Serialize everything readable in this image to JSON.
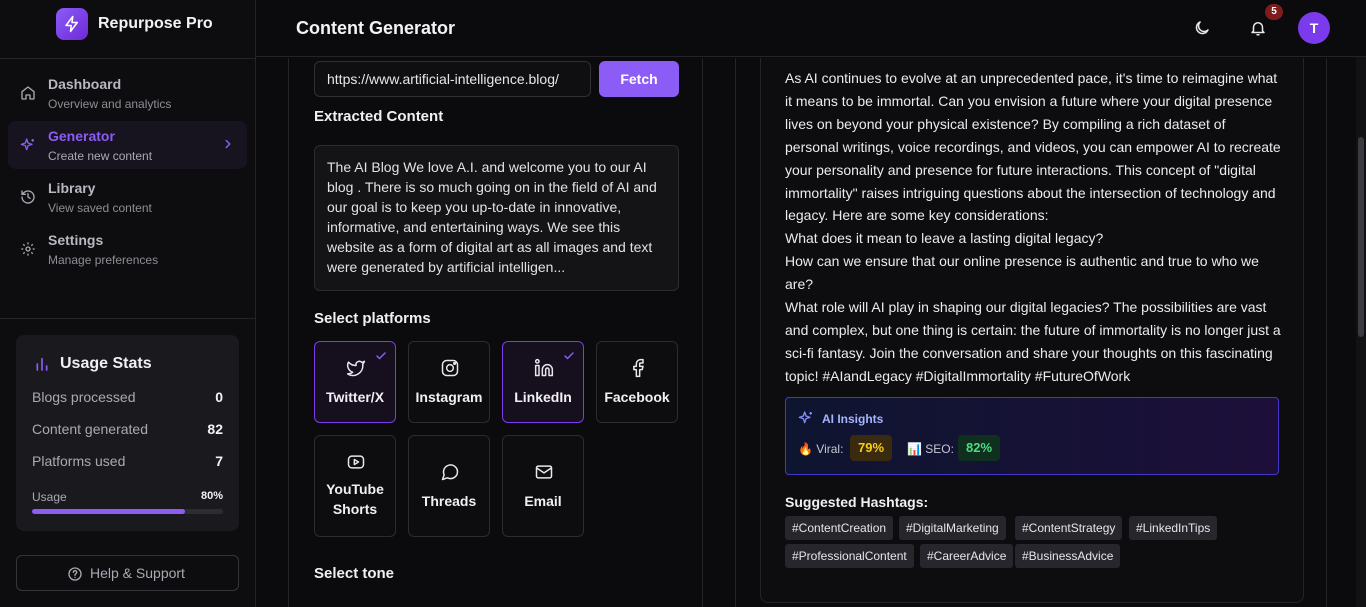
{
  "app": {
    "name": "Repurpose Pro"
  },
  "header": {
    "title": "Content Generator",
    "notification_count": "5",
    "avatar_initial": "T"
  },
  "sidebar": {
    "items": [
      {
        "label": "Dashboard",
        "sub": "Overview and analytics",
        "icon": "home-icon"
      },
      {
        "label": "Generator",
        "sub": "Create new content",
        "icon": "sparkles-icon",
        "active": true
      },
      {
        "label": "Library",
        "sub": "View saved content",
        "icon": "history-icon"
      },
      {
        "label": "Settings",
        "sub": "Manage preferences",
        "icon": "gear-icon"
      }
    ],
    "stats": {
      "title": "Usage Stats",
      "rows": [
        {
          "label": "Blogs processed",
          "value": "0"
        },
        {
          "label": "Content generated",
          "value": "82"
        },
        {
          "label": "Platforms used",
          "value": "7"
        }
      ],
      "usage_label": "Usage",
      "usage_pct": "80%",
      "usage_fraction": 0.8
    },
    "help": "Help & Support"
  },
  "generator": {
    "url_value": "https://www.artificial-intelligence.blog/",
    "fetch_label": "Fetch",
    "extracted_title": "Extracted Content",
    "extracted_text": "The AI Blog We love A.I. and welcome you to our AI blog . There is so much going on in the field of AI and our goal is to keep you up-to-date in innovative, informative, and entertaining ways. We see this website as a form of digital art as all images and text were generated by artificial intelligen...",
    "platforms_title": "Select platforms",
    "platforms": [
      {
        "label": "Twitter/X",
        "icon": "twitter-icon",
        "selected": true
      },
      {
        "label": "Instagram",
        "icon": "instagram-icon",
        "selected": false
      },
      {
        "label": "LinkedIn",
        "icon": "linkedin-icon",
        "selected": true
      },
      {
        "label": "Facebook",
        "icon": "facebook-icon",
        "selected": false
      },
      {
        "label": "YouTube Shorts",
        "icon": "youtube-icon",
        "selected": false
      },
      {
        "label": "Threads",
        "icon": "threads-icon",
        "selected": false
      },
      {
        "label": "Email",
        "icon": "mail-icon",
        "selected": false
      }
    ],
    "tone_title": "Select tone"
  },
  "output": {
    "paragraphs": [
      "As AI continues to evolve at an unprecedented pace, it's time to reimagine what it means to be immortal. Can you envision a future where your digital presence lives on beyond your physical existence? By compiling a rich dataset of personal writings, voice recordings, and videos, you can empower AI to recreate your personality and presence for future interactions. This concept of \"digital immortality\" raises intriguing questions about the intersection of technology and legacy. Here are some key considerations:",
      "What does it mean to leave a lasting digital legacy?",
      "How can we ensure that our online presence is authentic and true to who we are?",
      "What role will AI play in shaping our digital legacies? The possibilities are vast and complex, but one thing is certain: the future of immortality is no longer just a sci-fi fantasy. Join the conversation and share your thoughts on this fascinating topic! #AIandLegacy #DigitalImmortality #FutureOfWork"
    ],
    "insights_title": "AI Insights",
    "viral_label": "Viral:",
    "viral_value": "79%",
    "seo_label": "SEO:",
    "seo_value": "82%",
    "hashtags_title": "Suggested Hashtags:",
    "hashtags": [
      "#ContentCreation",
      "#DigitalMarketing",
      "#ContentStrategy",
      "#LinkedInTips",
      "#ProfessionalContent",
      "#CareerAdvice",
      "#BusinessAdvice"
    ]
  },
  "colors": {
    "accent": "#8b5cf6",
    "background": "#0b0b0d",
    "viral": "#facc15",
    "seo": "#4ade80"
  }
}
